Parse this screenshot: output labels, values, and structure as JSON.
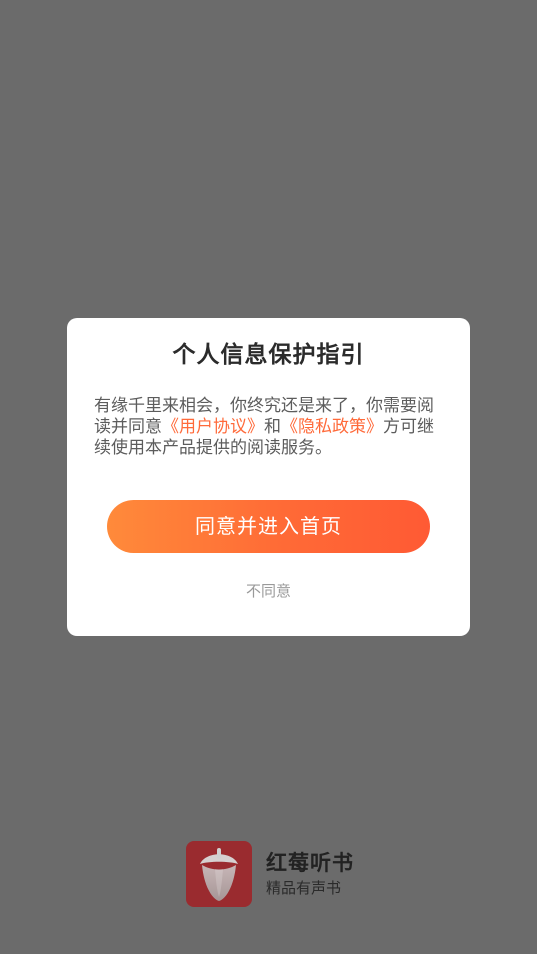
{
  "dialog": {
    "title": "个人信息保护指引",
    "body": {
      "text_1": "有缘千里来相会，你终究还是来了，你需要阅读并同意",
      "link_user_agreement": "《用户协议》",
      "text_and": "和",
      "link_privacy_policy": "《隐私政策》",
      "text_2": "方可继续使用本产品提供的阅读服务。"
    },
    "primary_button": "同意并进入首页",
    "secondary_button": "不同意"
  },
  "brand": {
    "logo_icon": "strawberry-logo-icon",
    "name": "红莓听书",
    "tagline": "精品有声书"
  },
  "colors": {
    "overlay": "#6b6b6b",
    "accent": "#ff6a3a",
    "brand_logo_bg": "#9a2b2f"
  }
}
